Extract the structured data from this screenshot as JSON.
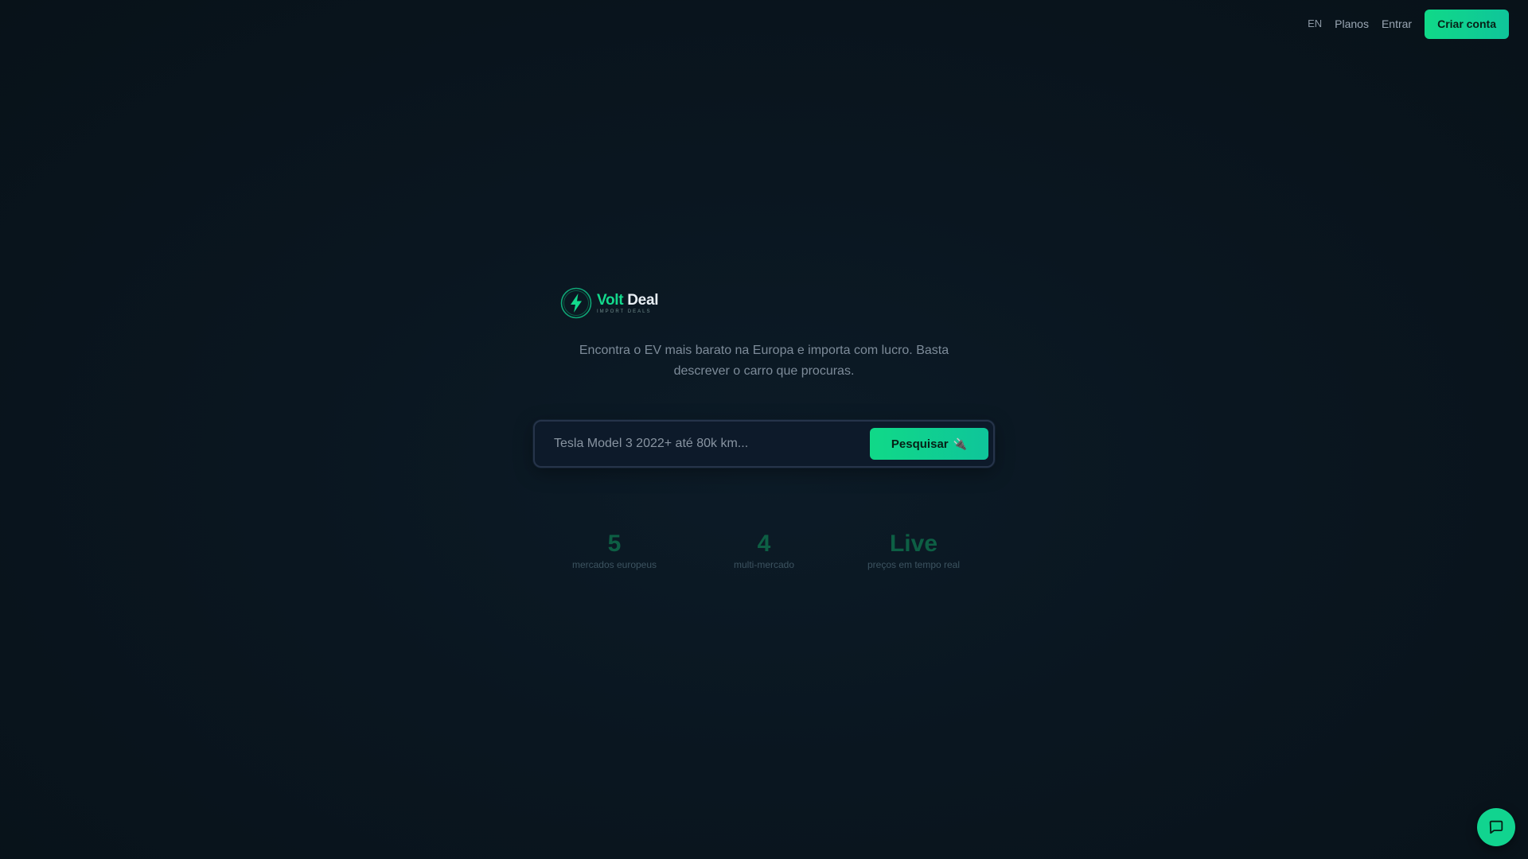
{
  "nav": {
    "lang_label": "EN",
    "plans_label": "Planos",
    "login_label": "Entrar",
    "signup_label": "Criar conta"
  },
  "brand": {
    "name_part1": "Volt",
    "name_part2": "Deal",
    "tagline": "IMPORT DEALS",
    "icon": "lightning-bolt-icon",
    "accent_color": "#13d98c"
  },
  "hero": {
    "subtitle": "Encontra o EV mais barato na Europa e importa com lucro. Basta descrever o carro que procuras."
  },
  "search": {
    "value": "",
    "placeholder": "Tesla Model 3 2022+ até 80k km...",
    "button_label": "Pesquisar",
    "button_icon": "🔌"
  },
  "stats": [
    {
      "value": "5",
      "label": "mercados europeus"
    },
    {
      "value": "4",
      "label": "multi-mercado"
    },
    {
      "value": "Live",
      "label": "preços em tempo real"
    }
  ],
  "chat": {
    "icon": "chat-bubble-icon"
  }
}
